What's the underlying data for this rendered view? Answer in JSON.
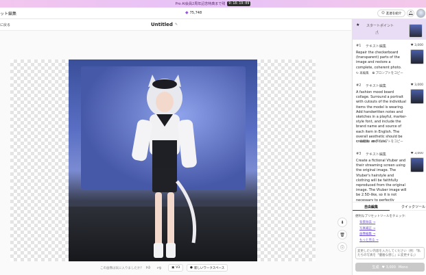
{
  "promo": {
    "text": "Pro AI会員2周年記念特典まで残",
    "timer": "9:18:19:09"
  },
  "header": {
    "app_title": "ット編集",
    "credits": "75,748",
    "refer_label": "友達を紹介"
  },
  "subbar": {
    "back_label": "に戻る",
    "doc_title": "Untitled"
  },
  "right_panel": {
    "start_label": "スタートポイント",
    "items": [
      {
        "num": "#1",
        "type": "テキスト編集",
        "cost": "3,000",
        "desc": "Repair the checkerboard (transparent) parts of the image and restore a complete, coherent photo.",
        "reedit": "再編集",
        "copy": "プロンプトをコピー"
      },
      {
        "num": "#2",
        "type": "テキスト編集",
        "cost": "3,000",
        "desc": "A fashion mood board collage. Surround a portrait with cutouts of the individual items the model is wearing. Add handwritten notes and sketches in a playful, marker-style font, and include the brand name and source of each item in English. The overall aesthetic should be creative and cute.",
        "reedit": "再編集",
        "copy": "プロンプトをコピー"
      },
      {
        "num": "#3",
        "type": "テキスト編集",
        "cost": "3,000",
        "desc": "Create a fictional Vtuber and their streaming screen using the original image. The Vtuber's hairstyle and clothing will be faithfully reproduced from the original image. The Vtuber image will be 2.5D-like, so it is not necessary to perfectly reproduce the style of the"
      }
    ],
    "tabs": {
      "free_edit": "自由編集",
      "quick_tool": "クイックツール"
    },
    "hint": "便利なプリセットツールをチェック:",
    "links": [
      "背景除去 →",
      "写真補正 →",
      "画像編集 →",
      "もっと見る →"
    ],
    "prompt_placeholder": "変更したい内容を入力してください（例：「私たちの写真を「優雅な感じ」に変更する」）",
    "generate_label": "生成",
    "generate_cost": "3,000",
    "generate_suffix": "Mono"
  },
  "bottom": {
    "feedback": "この画像は気に入りましたか？",
    "version_label": "V3",
    "new_workspace": "新しいワークスペース"
  }
}
